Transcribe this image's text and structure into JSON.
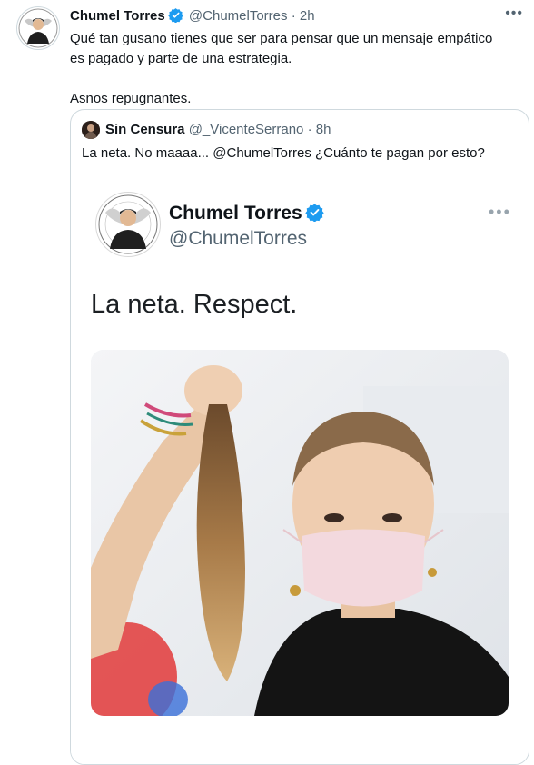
{
  "tweet": {
    "author_name": "Chumel Torres",
    "handle": "@ChumelTorres",
    "separator": "·",
    "time": "2h",
    "more_icon": "more-horizontal-icon",
    "text_line1": "Qué tan gusano tienes que ser para pensar que un mensaje empático es pagado y parte de una estrategia.",
    "text_line2": "Asnos repugnantes."
  },
  "quote": {
    "author_name": "Sin Censura",
    "handle": "@_VicenteSerrano",
    "separator": "·",
    "time": "8h",
    "text": "La neta. No maaaa... @ChumelTorres ¿Cuánto te pagan por esto?",
    "embedded": {
      "author_name": "Chumel Torres",
      "handle": "@ChumelTorres",
      "text": "La neta. Respect.",
      "more_icon": "more-horizontal-icon"
    }
  },
  "colors": {
    "verified": "#1d9bf0",
    "muted": "#536471",
    "border": "#cfd9de"
  }
}
